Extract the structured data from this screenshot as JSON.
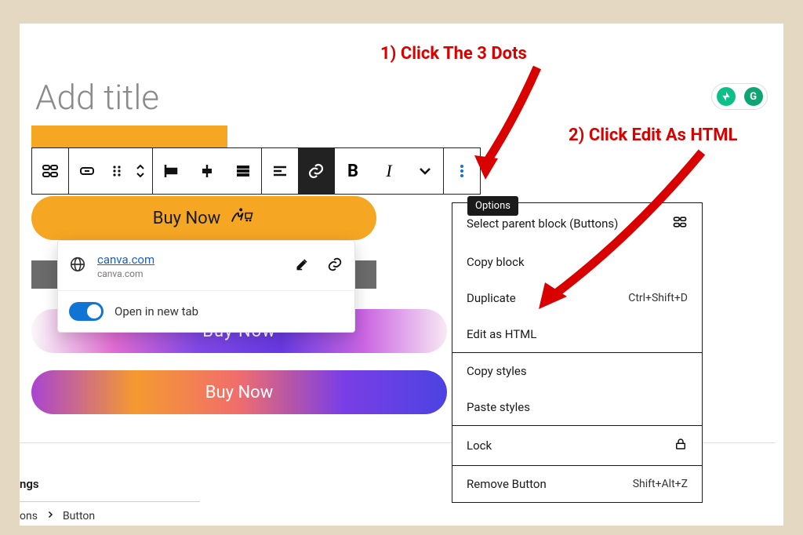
{
  "annotations": {
    "step1": "1) Click The 3 Dots",
    "step2": "2) Click Edit As HTML"
  },
  "title_placeholder": "Add title",
  "options_tooltip": "Options",
  "buttons": {
    "buy1": "Buy Now",
    "buy2": "Buy Now",
    "buy3": "Buy Now"
  },
  "link_popover": {
    "url": "canva.com",
    "domain": "canva.com",
    "open_new_tab_label": "Open in new tab"
  },
  "menu": {
    "select_parent": "Select parent block (Buttons)",
    "copy_block": "Copy block",
    "duplicate": "Duplicate",
    "duplicate_shortcut": "Ctrl+Shift+D",
    "edit_html": "Edit as HTML",
    "copy_styles": "Copy styles",
    "paste_styles": "Paste styles",
    "lock": "Lock",
    "remove": "Remove Button",
    "remove_shortcut": "Shift+Alt+Z"
  },
  "footer": {
    "tabs": "ngs",
    "breadcrumb_prefix": "ons",
    "breadcrumb_current": "Button"
  },
  "badges": {
    "grammarly": "G"
  }
}
